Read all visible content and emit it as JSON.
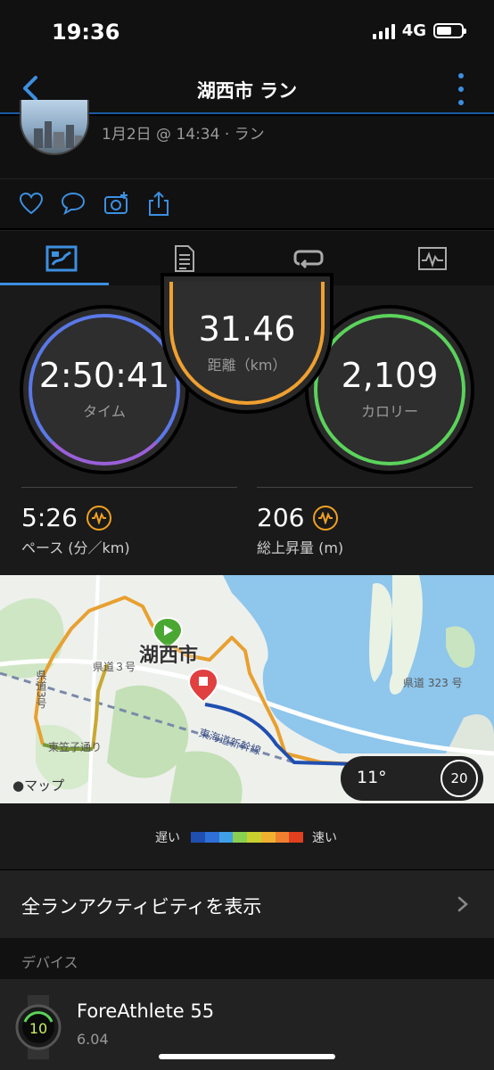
{
  "status_bar": {
    "time": "19:36",
    "network": "4G"
  },
  "nav": {
    "title": "湖西市 ラン"
  },
  "activity": {
    "meta": "1月2日 @ 14:34 · ラン"
  },
  "tabs": [
    {
      "name": "overview",
      "icon": "map-flag-icon",
      "active": true
    },
    {
      "name": "details",
      "icon": "document-icon",
      "active": false
    },
    {
      "name": "laps",
      "icon": "loop-icon",
      "active": false
    },
    {
      "name": "charts",
      "icon": "chart-icon",
      "active": false
    }
  ],
  "stats": {
    "distance": {
      "value": "31.46",
      "label": "距離（km）",
      "color": "#f0a030"
    },
    "time": {
      "value": "2:50:41",
      "label": "タイム",
      "color": "#5a8fe8"
    },
    "calories": {
      "value": "2,109",
      "label": "カロリー",
      "color": "#5bd35b"
    }
  },
  "metrics": {
    "pace": {
      "value": "5:26",
      "label": "ペース (分／km)"
    },
    "elevation": {
      "value": "206",
      "label": "総上昇量 (m)"
    }
  },
  "map": {
    "city_label": "湖西市",
    "road_route3": "県道３号",
    "road_route323": "県道 323 号",
    "road_vertical": "県道3号",
    "road_higashi": "東笠子通り",
    "rail_label": "東海道新幹線",
    "attribution": "マップ",
    "weather_temp": "11°",
    "wind_speed": "20"
  },
  "legend": {
    "slow": "遅い",
    "fast": "速い",
    "colors": [
      "#1f4fb0",
      "#2f6fd8",
      "#3fa0e8",
      "#8ad050",
      "#c8d030",
      "#f0b030",
      "#f08030",
      "#e04020"
    ]
  },
  "all_activities": {
    "label": "全ランアクティビティを表示"
  },
  "devices": {
    "section_label": "デバイス",
    "name": "ForeAthlete 55",
    "version": "6.04",
    "watch_face_number": "10"
  }
}
